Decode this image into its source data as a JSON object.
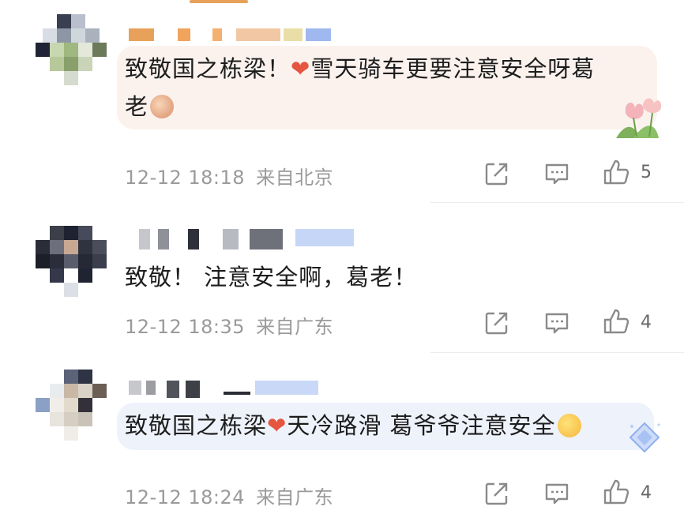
{
  "comments": [
    {
      "text": "致敬国之栋梁！",
      "text_after_heart": "雪天骑车更要注意安全呀葛",
      "text_line2": "老",
      "time": "12-12 18:18",
      "location": "来自北京",
      "like_count": "5"
    },
    {
      "text": "致敬！ 注意安全啊，葛老！",
      "time": "12-12 18:35",
      "location": "来自广东",
      "like_count": "4"
    },
    {
      "text": "致敬国之栋梁",
      "text_after_heart": "天冷路滑  葛爷爷注意安全",
      "time": "12-12 18:24",
      "location": "来自广东",
      "like_count": "4"
    }
  ],
  "icons": {
    "share": "share-icon",
    "comment": "comment-icon",
    "like": "thumbs-up-icon",
    "heart": "heart-icon"
  },
  "colors": {
    "meta_text": "#9a9a9a",
    "heart": "#e5553f",
    "bubble_1": "#fbf2ee",
    "bubble_3": "#eef2fb"
  }
}
